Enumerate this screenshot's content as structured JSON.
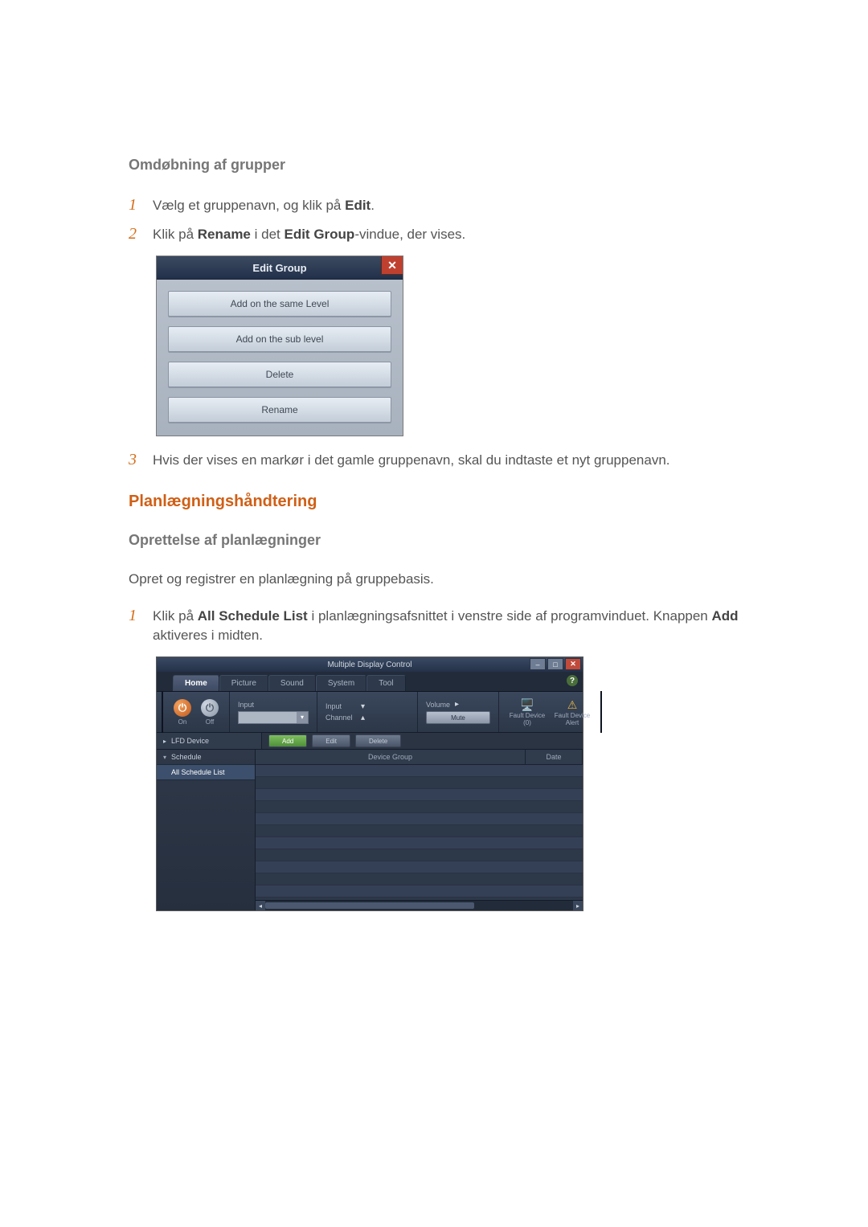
{
  "headings": {
    "rename_groups": "Omdøbning af grupper",
    "schedule_section": "Planlægningshåndtering",
    "create_schedules": "Oprettelse af planlægninger"
  },
  "steps_rename": {
    "n1": "1",
    "t1_a": "Vælg et gruppenavn, og klik på ",
    "t1_b": "Edit",
    "t1_c": ".",
    "n2": "2",
    "t2_a": "Klik på ",
    "t2_b": "Rename",
    "t2_c": " i det ",
    "t2_d": "Edit Group",
    "t2_e": "-vindue, der vises.",
    "n3": "3",
    "t3": "Hvis der vises en markør i det gamle gruppenavn, skal du indtaste et nyt gruppenavn."
  },
  "steps_sched": {
    "intro": "Opret og registrer en planlægning på gruppebasis.",
    "n1": "1",
    "t1_a": "Klik på ",
    "t1_b": "All Schedule List",
    "t1_c": " i planlægningsafsnittet i venstre side af programvinduet. Knappen ",
    "t1_d": "Add",
    "t1_e": " aktiveres i midten."
  },
  "edit_dialog": {
    "title": "Edit Group",
    "close": "✕",
    "buttons": {
      "same": "Add on the same Level",
      "sub": "Add on the sub level",
      "delete": "Delete",
      "rename": "Rename"
    }
  },
  "mdc": {
    "title": "Multiple Display Control",
    "win": {
      "min": "–",
      "max": "□",
      "close": "✕"
    },
    "help": "?",
    "tabs": {
      "home": "Home",
      "picture": "Picture",
      "sound": "Sound",
      "system": "System",
      "tool": "Tool"
    },
    "ribbon": {
      "on": "On",
      "off": "Off",
      "input": "Input",
      "channel": "Channel",
      "volume": "Volume",
      "mute": "Mute",
      "fault0": "Fault Device (0)",
      "alert": "Fault Device Alert"
    },
    "action": {
      "tree_head": "LFD Device",
      "add": "Add",
      "edit": "Edit",
      "delete": "Delete"
    },
    "tree": {
      "schedule": "Schedule",
      "all": "All Schedule List"
    },
    "grid": {
      "col1": "Device Group",
      "col2": "Date"
    }
  }
}
